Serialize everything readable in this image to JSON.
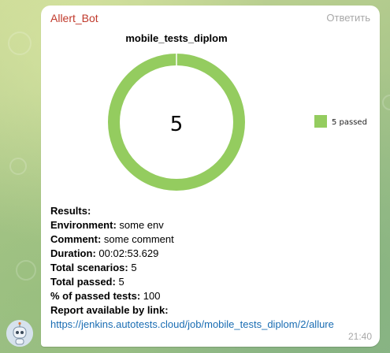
{
  "message": {
    "sender": "Allert_Bot",
    "reply_label": "Ответить",
    "time": "21:40",
    "avatar_icon": "robot-icon"
  },
  "chart_data": {
    "type": "pie",
    "title": "mobile_tests_diplom",
    "center_value": "5",
    "slices": [
      {
        "label": "5 passed",
        "value": 5,
        "color": "#94cc5f"
      }
    ],
    "legend_position": "right"
  },
  "details": {
    "results_label": "Results:",
    "environment_label": "Environment:",
    "environment_value": " some env",
    "comment_label": "Comment:",
    "comment_value": " some comment",
    "duration_label": "Duration:",
    "duration_value": " 00:02:53.629",
    "total_scenarios_label": "Total scenarios:",
    "total_scenarios_value": " 5",
    "total_passed_label": "Total passed:",
    "total_passed_value": " 5",
    "passed_pct_label": "% of passed tests:",
    "passed_pct_value": " 100",
    "report_label": "Report available by link:",
    "report_link": "https://jenkins.autotests.cloud/job/mobile_tests_diplom/2/allure"
  }
}
